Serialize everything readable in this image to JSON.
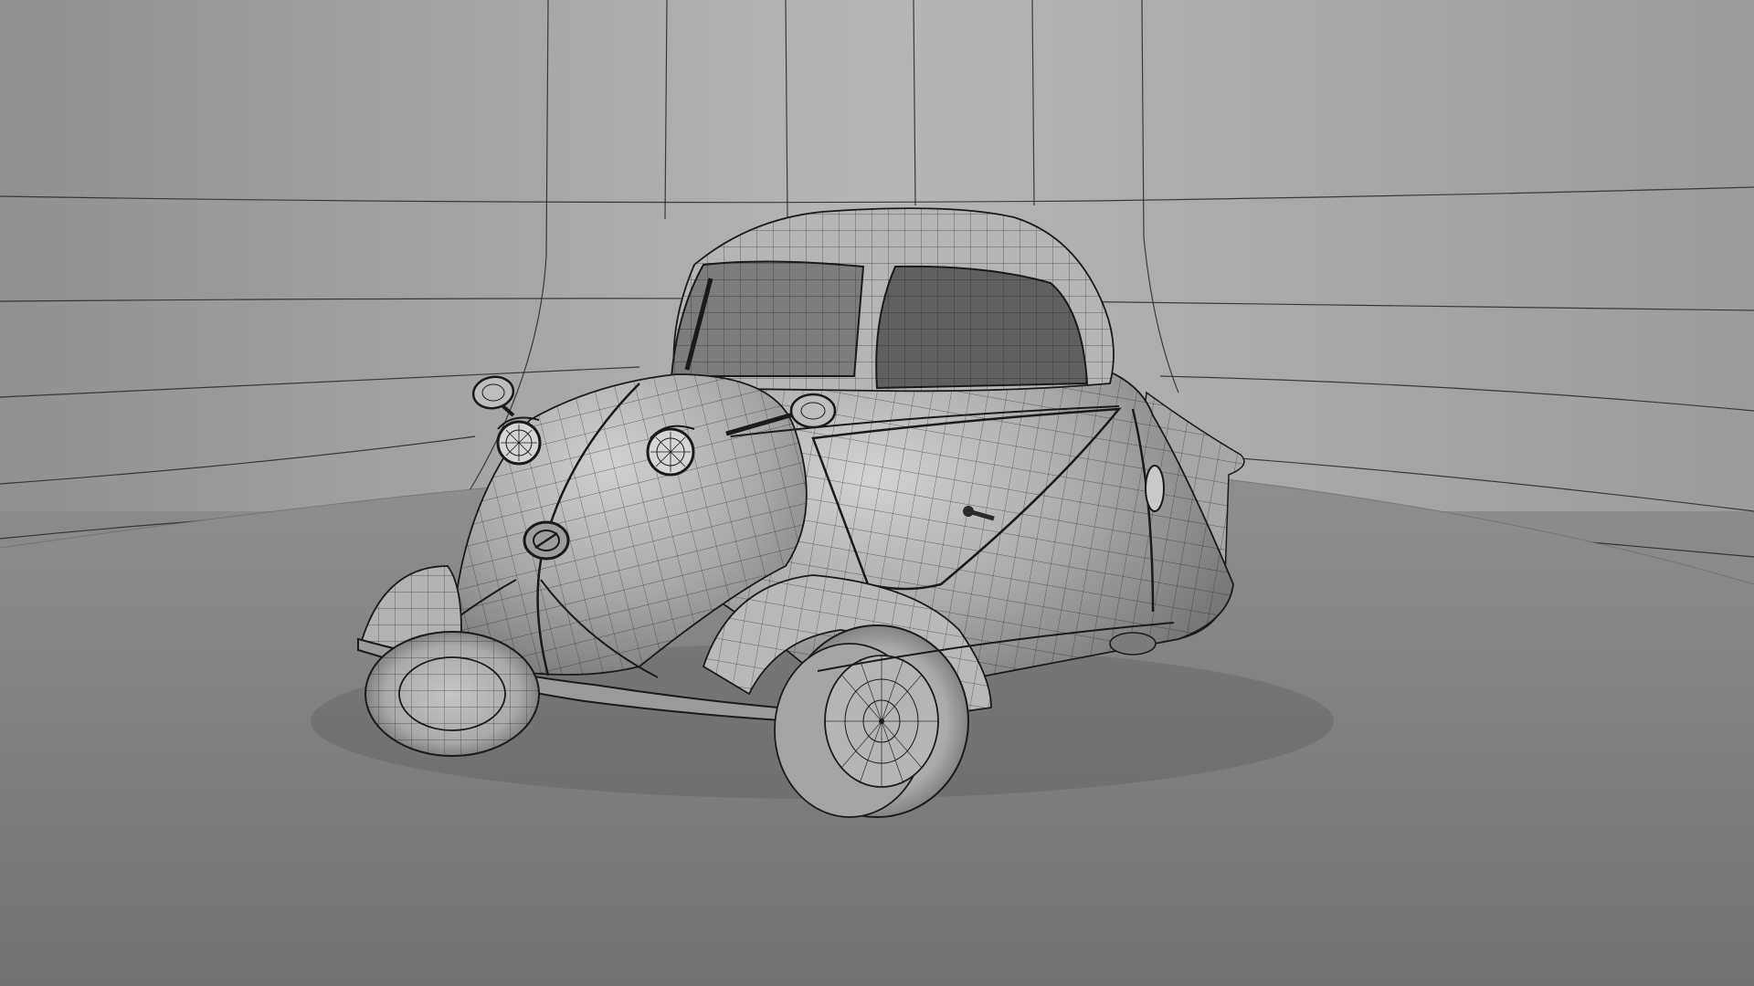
{
  "scene": {
    "subject": "microcar-wireframe-model",
    "render_mode": "wireframe-over-shaded",
    "colors": {
      "backdrop_light": "#b3b5b5",
      "backdrop_dark": "#8f9090",
      "floor_light": "#8e8f8f",
      "floor_dark": "#717272",
      "body_light": "#c9caca",
      "body_mid": "#9fa0a0",
      "body_dark": "#6e6f6f",
      "wire": "#1a1a1a",
      "window": "#5f6061"
    }
  }
}
